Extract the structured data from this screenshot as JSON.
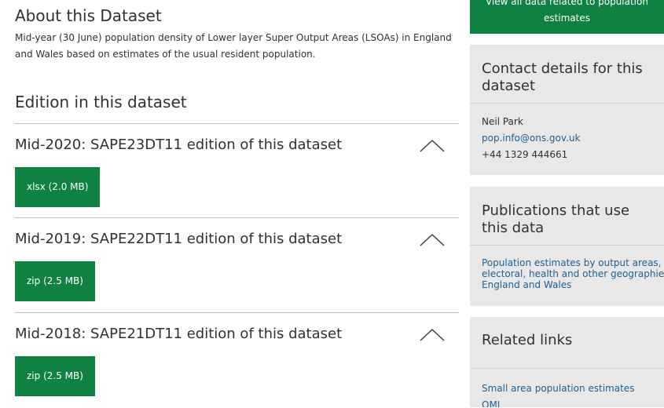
{
  "about": {
    "title": "About this Dataset",
    "description": "Mid-year (30 June) population density of Lower layer Super Output Areas (LSOAs) in England and Wales based on estimates of the usual resident population."
  },
  "editions_heading": "Edition in this dataset",
  "editions": [
    {
      "title": "Mid-2020: SAPE23DT11 edition of this dataset",
      "download_label": "xlsx (2.0 MB)",
      "expanded": true
    },
    {
      "title": "Mid-2019: SAPE22DT11 edition of this dataset",
      "download_label": "zip (2.5 MB)",
      "expanded": true
    },
    {
      "title": "Mid-2018: SAPE21DT11 edition of this dataset",
      "download_label": "zip (2.5 MB)",
      "expanded": true
    }
  ],
  "sidebar": {
    "cta": {
      "line1": "View all data related to population",
      "line2": "estimates"
    },
    "contact": {
      "title": "Contact details for this dataset",
      "name": "Neil Park",
      "email": "pop.info@ons.gov.uk",
      "phone": "+44 1329 444661"
    },
    "publications": {
      "title": "Publications that use this data",
      "link_lines": [
        "Population estimates by output areas,",
        "electoral, health and other geographies,",
        "England and Wales"
      ]
    },
    "related": {
      "title": "Related links",
      "link": "Small area population estimates QMI"
    }
  },
  "colors": {
    "accent_green": "#0f8243",
    "link_blue": "#206095",
    "sidebar_bg": "#e8e8e8",
    "text": "#323132"
  }
}
